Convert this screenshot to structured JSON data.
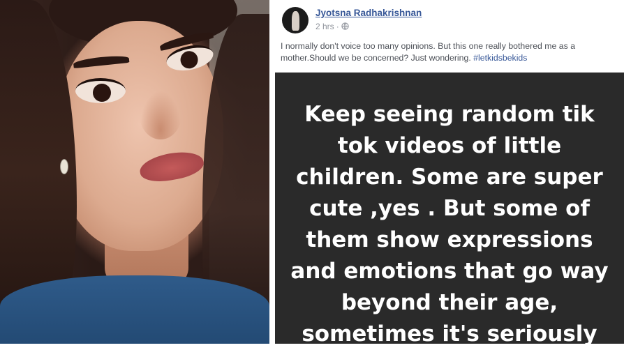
{
  "post": {
    "author": "Jyotsna Radhakrishnan",
    "timestamp": "2 hrs",
    "privacy_icon": "globe-icon",
    "text_line1": "I normally don't voice too many opinions. But this one really bothered me as a",
    "text_line2": "mother.Should we be concerned? Just wondering. ",
    "hashtag": "#letkidsbekids",
    "story": {
      "lines": [
        "Keep seeing random tik",
        "tok videos of little",
        "children. Some are super",
        "cute ,yes . But some of",
        "them show expressions",
        "and emotions that go way",
        "beyond their age,",
        "sometimes it's seriously"
      ]
    }
  },
  "colors": {
    "link": "#385898",
    "meta": "#90949c",
    "story_bg": "#2a2a2a"
  }
}
